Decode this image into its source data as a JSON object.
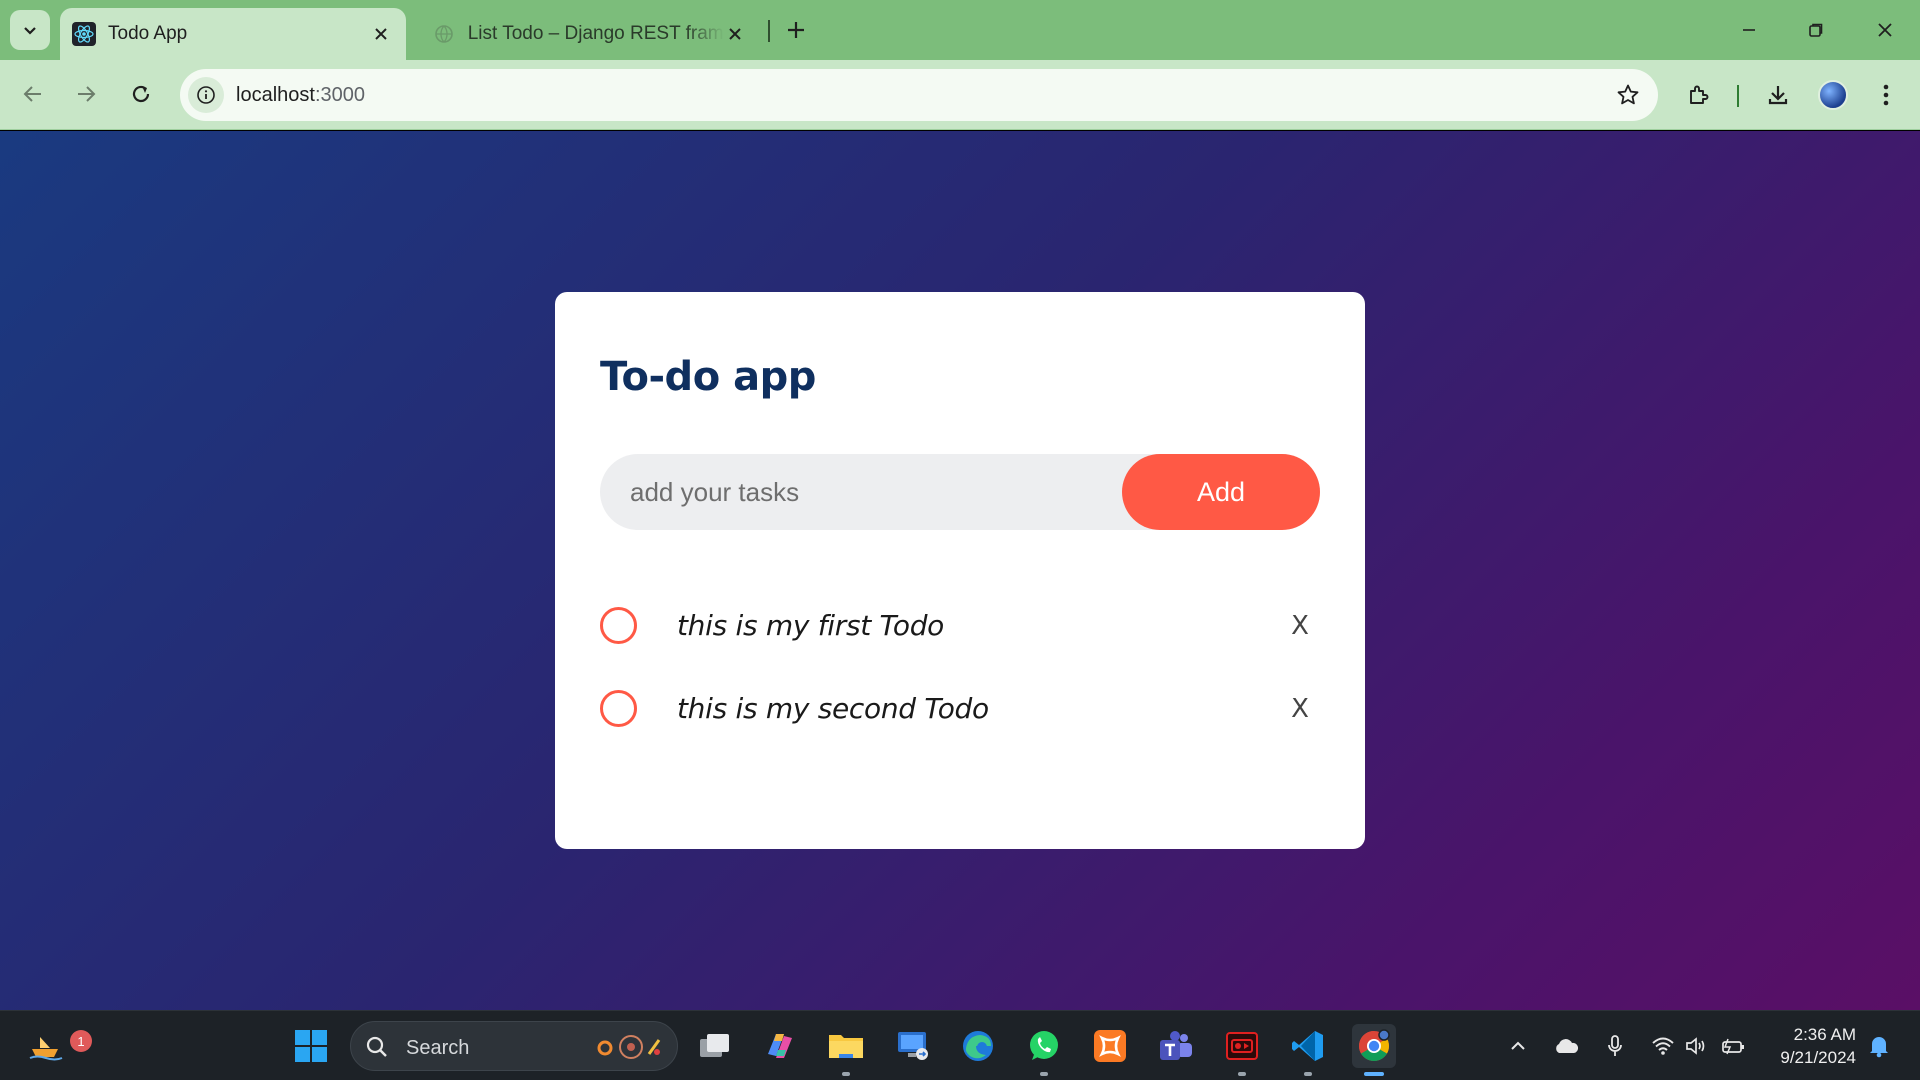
{
  "browser": {
    "tabs": [
      {
        "title": "Todo App",
        "active": true
      },
      {
        "title": "List Todo – Django REST framework",
        "active": false
      }
    ],
    "url_host": "localhost",
    "url_port": ":3000"
  },
  "app": {
    "title": "To-do app",
    "input_placeholder": "add your tasks",
    "add_label": "Add",
    "accent_color": "#ff5945",
    "todos": [
      {
        "text": "this is my first Todo",
        "delete_label": "X"
      },
      {
        "text": "this is my second Todo",
        "delete_label": "X"
      }
    ]
  },
  "taskbar": {
    "search_label": "Search",
    "notification_count": "1",
    "time": "2:36 AM",
    "date": "9/21/2024"
  }
}
